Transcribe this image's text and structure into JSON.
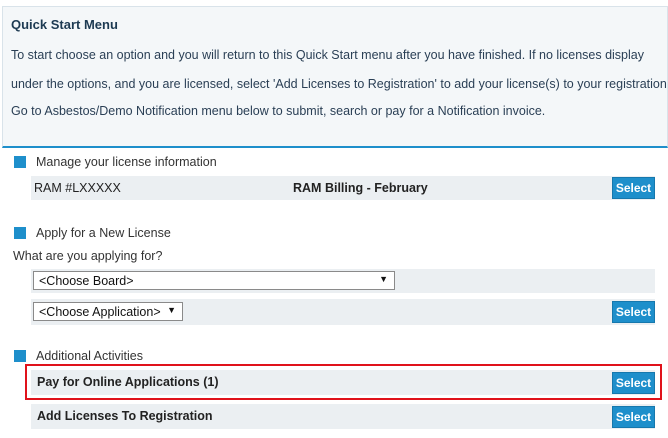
{
  "quick_start": {
    "title": "Quick Start Menu",
    "line1": "To start choose an option and you will return to this Quick Start menu after you have finished. If no licenses display",
    "line2": "under the options, and you are licensed, select 'Add Licenses to Registration' to add your license(s) to your registration.",
    "line3": "Go to Asbestos/Demo Notification menu below to submit, search or pay for a Notification invoice."
  },
  "manage": {
    "label": "Manage your license information",
    "license_number": "RAM #LXXXXX",
    "billing": "RAM Billing - February",
    "button": "Select"
  },
  "apply": {
    "label": "Apply for a New License",
    "question": "What are you applying for?",
    "board_select": "<Choose Board>",
    "application_select": "<Choose Application>",
    "button": "Select"
  },
  "additional": {
    "label": "Additional Activities",
    "pay_online": "Pay for Online Applications (1)",
    "pay_button": "Select",
    "add_licenses": "Add Licenses To Registration",
    "add_button": "Select"
  },
  "colors": {
    "accent": "#1e8fcb",
    "highlight": "#e0121b",
    "row_bg": "#ebeff2"
  }
}
